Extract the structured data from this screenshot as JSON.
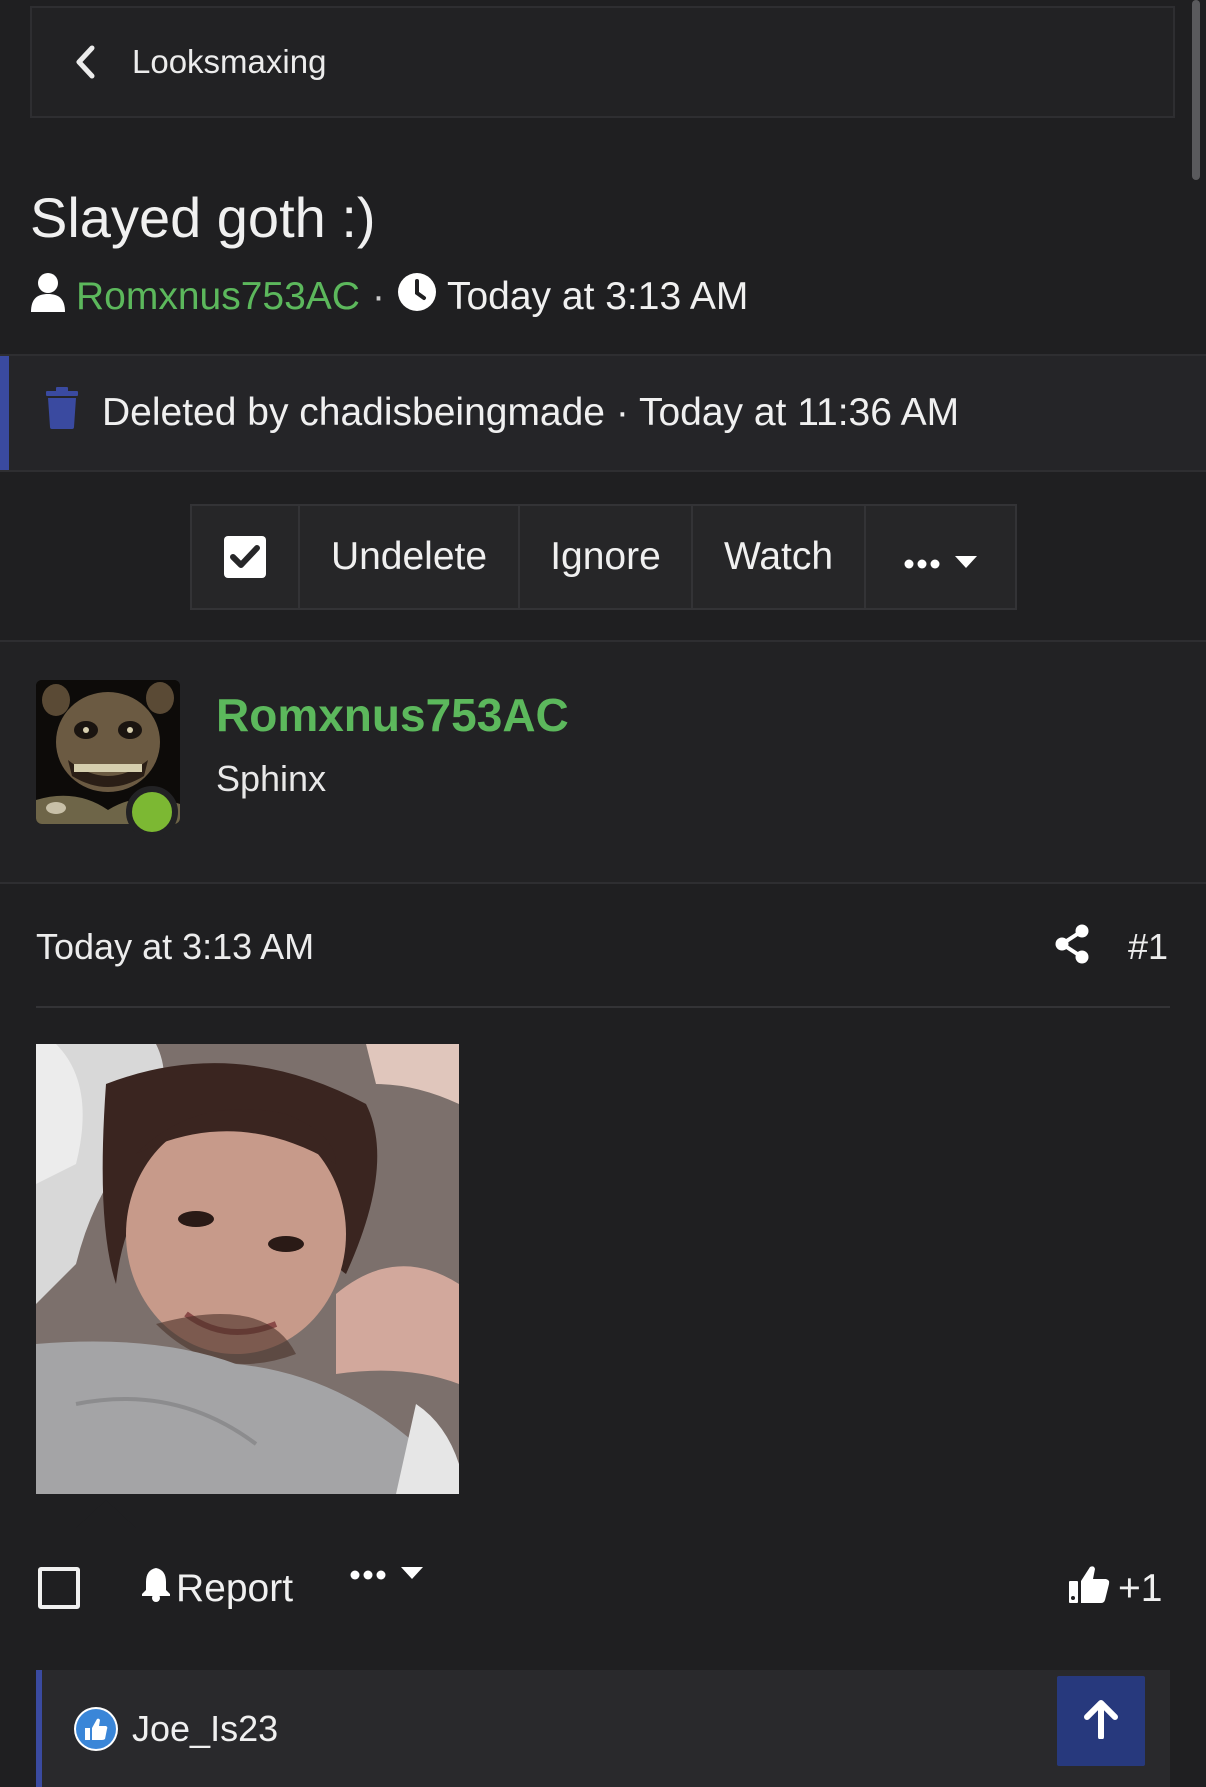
{
  "breadcrumb": {
    "label": "Looksmaxing",
    "icon": "chevron-left-icon"
  },
  "thread": {
    "title": "Slayed goth :)",
    "author": "Romxnus753AC",
    "separator": "·",
    "time": "Today at 3:13 AM"
  },
  "deleted_notice": {
    "text": "Deleted by chadisbeingmade · Today at 11:36 AM",
    "icon": "trash-icon"
  },
  "actions": {
    "undelete": "Undelete",
    "ignore": "Ignore",
    "watch": "Watch"
  },
  "post": {
    "username": "Romxnus753AC",
    "user_title": "Sphinx",
    "time": "Today at 3:13 AM",
    "number": "#1",
    "report_label": "Report",
    "reaction_count": "+1",
    "reaction_user": "Joe_Is23"
  },
  "colors": {
    "accent_green": "#5cb85c",
    "online_dot": "#7cb833",
    "notice_bar": "#3a4aa0",
    "scroll_top_button": "#27397d",
    "background": "#1f1f21"
  }
}
